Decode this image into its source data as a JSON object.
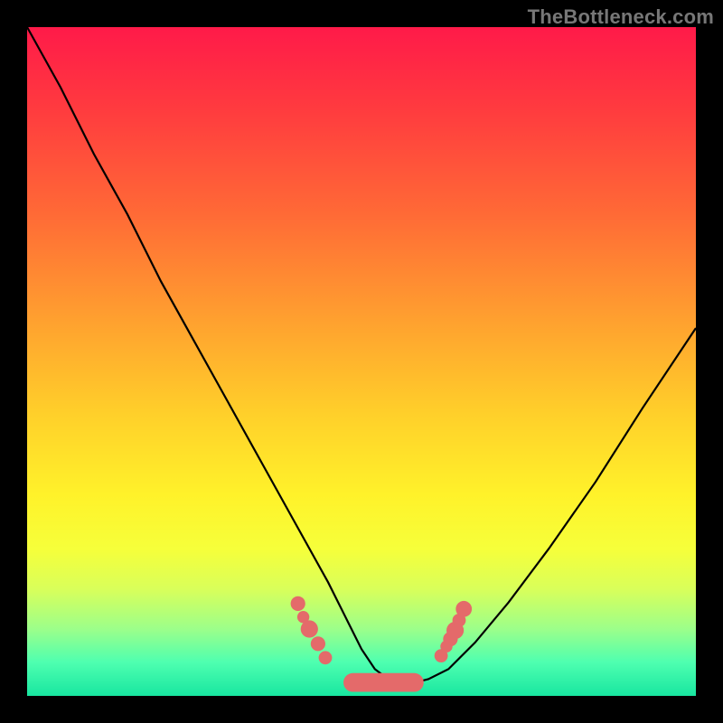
{
  "watermark": "TheBottleneck.com",
  "chart_data": {
    "type": "line",
    "title": "",
    "xlabel": "",
    "ylabel": "",
    "xlim": [
      0,
      100
    ],
    "ylim": [
      0,
      100
    ],
    "grid": false,
    "legend": false,
    "series": [
      {
        "name": "bottleneck-curve",
        "x": [
          0,
          5,
          10,
          15,
          20,
          25,
          30,
          35,
          40,
          45,
          48,
          50,
          52,
          54,
          56,
          58,
          60,
          63,
          67,
          72,
          78,
          85,
          92,
          100
        ],
        "y": [
          100,
          91,
          81,
          72,
          62,
          53,
          44,
          35,
          26,
          17,
          11,
          7,
          4,
          2.5,
          2,
          2,
          2.5,
          4,
          8,
          14,
          22,
          32,
          43,
          55
        ]
      }
    ],
    "markers": [
      {
        "x": 40.5,
        "y": 13.8,
        "r": 1.1
      },
      {
        "x": 41.3,
        "y": 11.8,
        "r": 0.9
      },
      {
        "x": 42.2,
        "y": 10.0,
        "r": 1.3
      },
      {
        "x": 43.5,
        "y": 7.8,
        "r": 1.1
      },
      {
        "x": 44.6,
        "y": 5.7,
        "r": 1.0
      },
      {
        "x": 61.9,
        "y": 6.0,
        "r": 1.0
      },
      {
        "x": 62.7,
        "y": 7.4,
        "r": 0.9
      },
      {
        "x": 63.3,
        "y": 8.5,
        "r": 1.1
      },
      {
        "x": 64.0,
        "y": 9.8,
        "r": 1.3
      },
      {
        "x": 64.6,
        "y": 11.3,
        "r": 1.0
      },
      {
        "x": 65.3,
        "y": 13.0,
        "r": 1.2
      }
    ],
    "pill": {
      "x0": 47.3,
      "x1": 59.3,
      "y": 2.0,
      "r": 1.4
    }
  }
}
